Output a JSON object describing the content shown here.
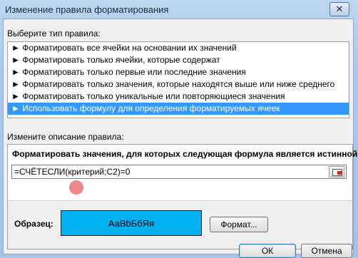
{
  "window": {
    "title": "Изменение правила форматирования",
    "close_glyph": "✕"
  },
  "rule_type": {
    "label": "Выберите тип правила:",
    "items": [
      "► Форматировать все ячейки на основании их значений",
      "► Форматировать только ячейки, которые содержат",
      "► Форматировать только первые или последние значения",
      "► Форматировать только значения, которые находятся выше или ниже среднего",
      "► Форматировать только уникальные или повторяющиеся значения",
      "► Использовать формулу для определения форматируемых ячеек"
    ],
    "selected_index": 5
  },
  "description": {
    "label": "Измените описание правила:",
    "formula_heading": "Форматировать значения, для которых следующая формула является истинной:",
    "formula_value": "=СЧЁТЕСЛИ(критерий;C2)=0"
  },
  "preview": {
    "label": "Образец:",
    "sample_text": "АаВbБбЯя",
    "fill_color": "#00b0f0"
  },
  "buttons": {
    "format": "Формат...",
    "ok": "ОК",
    "cancel": "Отмена"
  }
}
